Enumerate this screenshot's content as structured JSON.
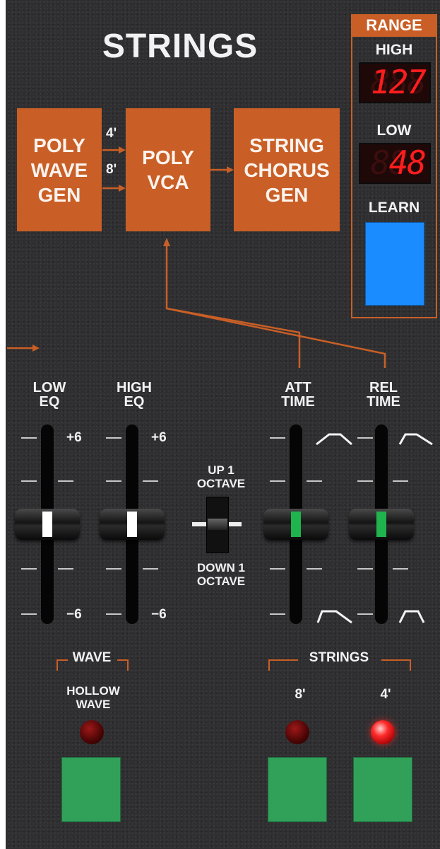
{
  "module": {
    "title": "STRINGS",
    "accent_color": "#c95f26",
    "panel_color": "#2f2f31"
  },
  "signal_flow": {
    "blocks": [
      {
        "name": "poly-wave-gen",
        "label": "POLY\nWAVE\nGEN"
      },
      {
        "name": "poly-vca",
        "label": "POLY\nVCA"
      },
      {
        "name": "string-chorus-gen",
        "label": "STRING\nCHORUS\nGEN"
      }
    ],
    "footages": [
      "4'",
      "8'"
    ]
  },
  "range": {
    "header": "RANGE",
    "high_label": "HIGH",
    "high_value": "127",
    "low_label": "LOW",
    "low_value": "48",
    "learn_label": "LEARN",
    "learn_color": "#1a8cff"
  },
  "sliders": [
    {
      "name": "low-eq",
      "label": "LOW\nEQ",
      "scale_top": "+6",
      "scale_bottom": "−6",
      "level": 0.5,
      "indicator_color": "#ffffff"
    },
    {
      "name": "high-eq",
      "label": "HIGH\nEQ",
      "scale_top": "+6",
      "scale_bottom": "−6",
      "level": 0.5,
      "indicator_color": "#ffffff"
    },
    {
      "name": "att-time",
      "label": "ATT\nTIME",
      "level": 0.5,
      "top_icon": "fast-attack-envelope-icon",
      "bottom_icon": "slow-attack-envelope-icon",
      "indicator_color": "#1fb44d"
    },
    {
      "name": "rel-time",
      "label": "REL\nTIME",
      "level": 0.5,
      "top_icon": "short-release-envelope-icon",
      "bottom_icon": "long-release-envelope-icon",
      "indicator_color": "#1fb44d"
    }
  ],
  "octave_switch": {
    "up_label": "UP 1\nOCTAVE",
    "down_label": "DOWN 1\nOCTAVE",
    "position": "center"
  },
  "wave": {
    "group_label": "WAVE",
    "hollow_label": "HOLLOW\nWAVE",
    "hollow_led_on": false
  },
  "strings": {
    "group_label": "STRINGS",
    "buttons": [
      {
        "label": "8'",
        "led_on": false
      },
      {
        "label": "4'",
        "led_on": true
      }
    ],
    "button_color": "#31a15a"
  }
}
